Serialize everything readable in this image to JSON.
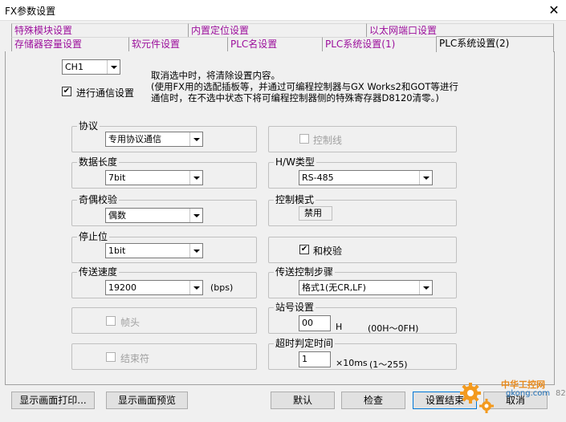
{
  "window": {
    "title": "FX参数设置",
    "close_glyph": "✕"
  },
  "tabs_row1": [
    "特殊模块设置",
    "内置定位设置",
    "以太网端口设置"
  ],
  "tabs_row2": [
    "存储器容量设置",
    "软元件设置",
    "PLC名设置",
    "PLC系统设置(1)",
    "PLC系统设置(2)"
  ],
  "channel": {
    "value": "CH1"
  },
  "comm": {
    "label": "进行通信设置",
    "checked": true
  },
  "note": "取消选中时，将清除设置内容。\n(使用FX用的选配插板等，并通过可编程控制器与GX Works2和GOT等进行\n通信时，在不选中状态下将可编程控制器侧的特殊寄存器D8120清零。)",
  "protocol": {
    "title": "协议",
    "value": "专用协议通信"
  },
  "control_line": {
    "label": "控制线"
  },
  "data_length": {
    "title": "数据长度",
    "value": "7bit"
  },
  "hw_type": {
    "title": "H/W类型",
    "value": "RS-485"
  },
  "parity": {
    "title": "奇偶校验",
    "value": "偶数"
  },
  "control_mode": {
    "title": "控制模式",
    "value": "禁用"
  },
  "stop_bit": {
    "title": "停止位",
    "value": "1bit"
  },
  "checksum": {
    "label": "和校验",
    "checked": true
  },
  "baud": {
    "title": "传送速度",
    "value": "19200",
    "unit": "(bps)"
  },
  "transfer_step": {
    "title": "传送控制步骤",
    "value": "格式1(无CR,LF)"
  },
  "header": {
    "label": "帧头"
  },
  "station": {
    "title": "站号设置",
    "value": "00",
    "unit": "H",
    "range": "(00H～0FH)"
  },
  "terminator": {
    "label": "结束符"
  },
  "timeout": {
    "title": "超时判定时间",
    "value": "1",
    "unit": "×10ms",
    "range": "(1～255)"
  },
  "buttons": {
    "print": "显示画面打印...",
    "preview": "显示画面预览",
    "default": "默认",
    "check": "检查",
    "finish": "设置结束",
    "cancel": "取消"
  },
  "watermark": {
    "line1": "中华工控网",
    "line2": "gkong.com",
    "side": "82"
  }
}
